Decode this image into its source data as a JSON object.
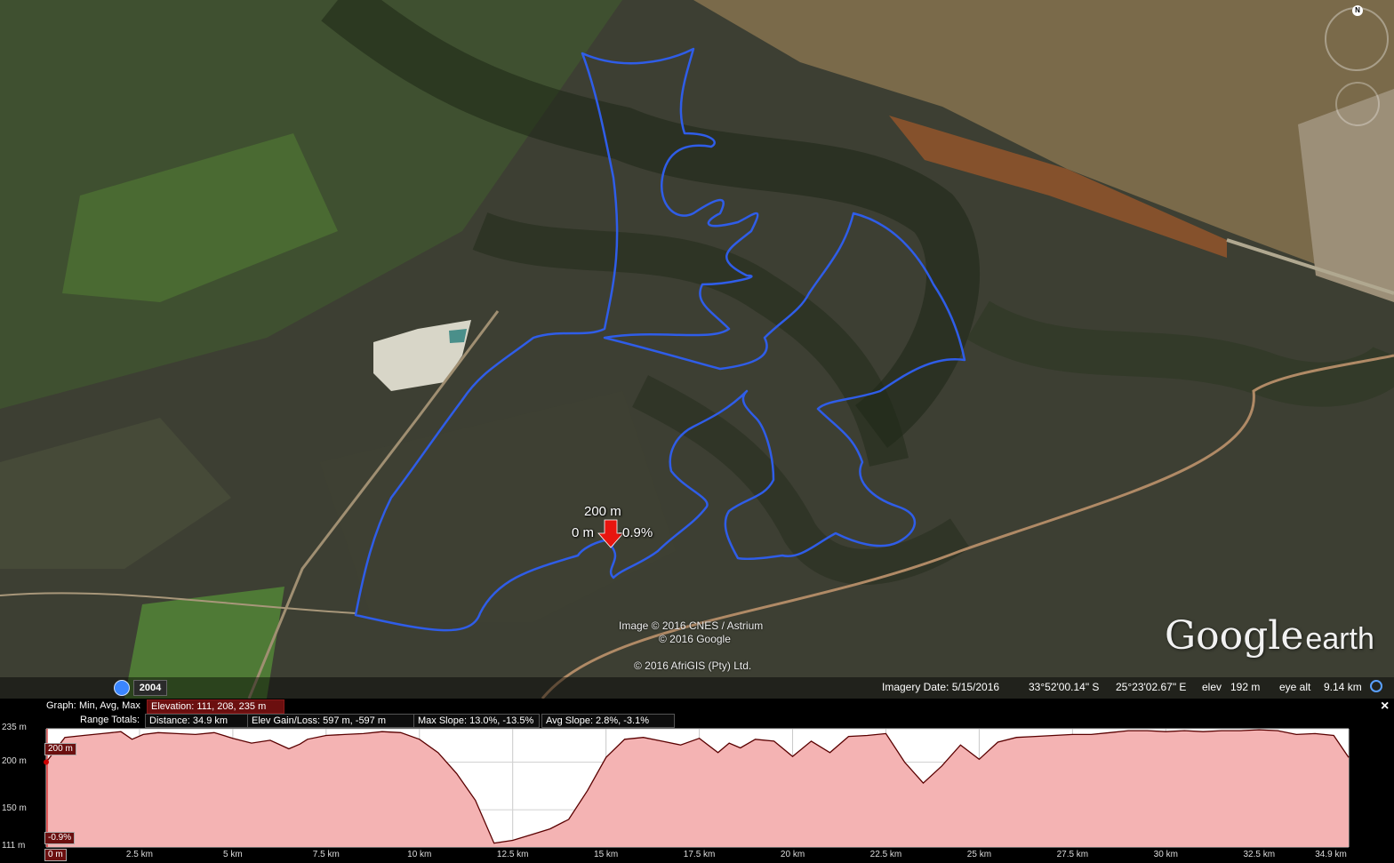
{
  "map": {
    "marker_distance_label": "200 m",
    "marker_offset_label": "0 m",
    "marker_slope_label": "-0.9%",
    "credits": [
      "Image © 2016 CNES / Astrium",
      "© 2016 Google",
      "© 2016 AfriGIS (Pty) Ltd."
    ],
    "logo": {
      "google": "Google",
      "earth": "earth"
    },
    "compass_north": "N",
    "track_color": "#2f5de8",
    "marker_color": "#e8150f"
  },
  "statusbar": {
    "year": "2004",
    "imagery_date": "Imagery Date: 5/15/2016",
    "lat": "33°52'00.14\" S",
    "lon": "25°23'02.67\" E",
    "elev_label": "elev",
    "elev_value": "192 m",
    "eye_alt_label": "eye alt",
    "eye_alt_value": "9.14 km"
  },
  "graph": {
    "graph_label": "Graph:",
    "mode_label": "Min, Avg, Max",
    "elevation": "Elevation: 111, 208, 235 m",
    "range_totals_label": "Range Totals:",
    "distance": "Distance: 34.9 km",
    "elev_gain_loss": "Elev Gain/Loss: 597 m, -597 m",
    "max_slope": "Max Slope: 13.0%, -13.5%",
    "avg_slope": "Avg Slope: 2.8%, -3.1%",
    "cursor_elev_tag": "200 m",
    "cursor_slope_tag": "-0.9%",
    "cursor_dist_tag": "0 m",
    "close_label": "×"
  },
  "chart_data": {
    "type": "area",
    "title": "",
    "xlabel": "",
    "ylabel": "",
    "x_unit": "km",
    "xlim": [
      0,
      34.9
    ],
    "ylim": [
      111,
      235
    ],
    "y_ticks": [
      "235 m",
      "200 m",
      "150 m",
      "111 m"
    ],
    "y_tick_values": [
      235,
      200,
      150,
      111
    ],
    "x_ticks": [
      "0 m",
      "2.5 km",
      "5 km",
      "7.5 km",
      "10 km",
      "12.5 km",
      "15 km",
      "17.5 km",
      "20 km",
      "22.5 km",
      "25 km",
      "27.5 km",
      "30 km",
      "32.5 km",
      "34.9 km"
    ],
    "x_tick_values": [
      0,
      2.5,
      5,
      7.5,
      10,
      12.5,
      15,
      17.5,
      20,
      22.5,
      25,
      27.5,
      30,
      32.5,
      34.9
    ],
    "grid": true,
    "line_color": "#5a0000",
    "fill_color": "#f4b3b3",
    "series": [
      {
        "x": [
          0,
          0.5,
          1,
          1.5,
          2,
          2.3,
          2.6,
          3,
          3.5,
          4,
          4.5,
          5,
          5.5,
          6,
          6.5,
          6.8,
          7,
          7.5,
          8,
          8.5,
          9,
          9.5,
          10,
          10.5,
          11,
          11.5,
          12,
          12.5,
          13,
          13.5,
          14,
          14.5,
          15,
          15.5,
          16,
          16.5,
          17,
          17.5,
          18,
          18.3,
          18.6,
          19,
          19.5,
          20,
          20.5,
          21,
          21.5,
          22,
          22.5,
          23,
          23.5,
          24,
          24.5,
          25,
          25.5,
          26,
          26.5,
          27,
          27.5,
          28,
          28.5,
          29,
          29.5,
          30,
          30.5,
          31,
          31.5,
          32,
          32.5,
          33,
          33.5,
          34,
          34.5,
          34.9
        ],
        "y": [
          200,
          226,
          228,
          230,
          232,
          224,
          229,
          231,
          230,
          229,
          231,
          225,
          220,
          223,
          214,
          219,
          224,
          228,
          229,
          230,
          232,
          231,
          224,
          210,
          188,
          160,
          115,
          118,
          124,
          130,
          140,
          170,
          205,
          224,
          226,
          222,
          218,
          225,
          210,
          220,
          215,
          224,
          222,
          206,
          222,
          210,
          227,
          228,
          230,
          200,
          178,
          196,
          218,
          203,
          221,
          226,
          227,
          228,
          229,
          229,
          231,
          233,
          233,
          232,
          233,
          232,
          233,
          233,
          234,
          233,
          229,
          230,
          228,
          205
        ]
      }
    ]
  }
}
